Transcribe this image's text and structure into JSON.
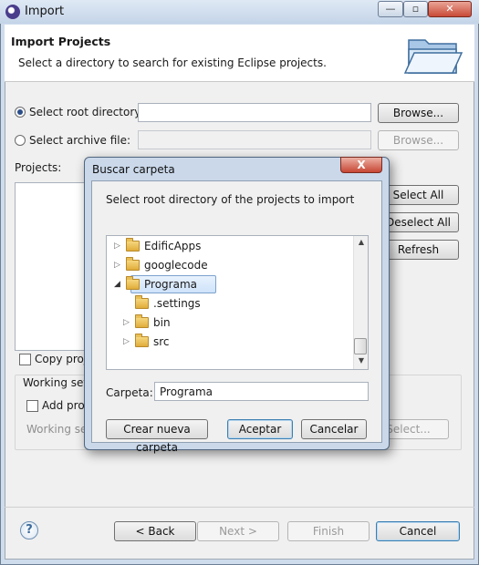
{
  "window": {
    "title": "Import"
  },
  "header": {
    "title": "Import Projects",
    "description": "Select a directory to search for existing Eclipse projects."
  },
  "source": {
    "root_label": "Select root directory:",
    "root_value": "",
    "archive_label": "Select archive file:",
    "archive_value": "",
    "browse_label": "Browse..."
  },
  "projects": {
    "label": "Projects:",
    "select_all": "Select All",
    "deselect_all": "Deselect All",
    "refresh": "Refresh"
  },
  "options": {
    "copy_label": "Copy proje",
    "working_sets_label": "Working sets",
    "add_label": "Add proje",
    "working_label": "Working set",
    "select_label": "Select..."
  },
  "footer": {
    "back": "< Back",
    "next": "Next >",
    "finish": "Finish",
    "cancel": "Cancel"
  },
  "dialog": {
    "title": "Buscar carpeta",
    "close": "X",
    "description": "Select root directory of the projects to import",
    "tree": [
      {
        "label": "EdificApps",
        "expander": "▷"
      },
      {
        "label": "googlecode",
        "expander": "▷"
      },
      {
        "label": "Programa",
        "expander": "◢",
        "selected": true
      },
      {
        "label": ".settings",
        "expander": ""
      },
      {
        "label": "bin",
        "expander": "▷"
      },
      {
        "label": "src",
        "expander": "▷"
      }
    ],
    "folder_label": "Carpeta:",
    "folder_value": "Programa",
    "new_folder": "Crear nueva carpeta",
    "accept": "Aceptar",
    "cancel": "Cancelar"
  },
  "icons": {
    "app": "eclipse-icon",
    "help": "help-icon",
    "folder": "folder-icon"
  },
  "colors": {
    "accent": "#3c7fb1",
    "selection": "#cfe3fa",
    "close": "#c74633"
  }
}
